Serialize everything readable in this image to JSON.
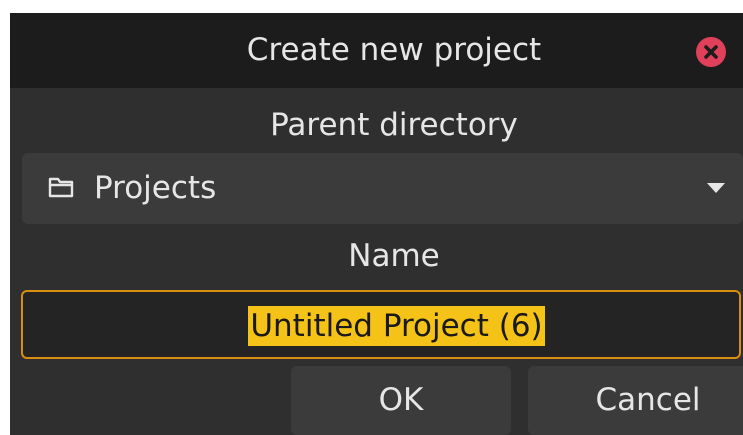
{
  "dialog": {
    "title": "Create new project",
    "close_icon": "close-icon",
    "accent_color": "#d98e12",
    "selection_color": "#f5c318"
  },
  "parent_directory": {
    "label": "Parent directory",
    "selected": "Projects",
    "icon": "folder-icon",
    "dropdown_icon": "chevron-down-icon"
  },
  "name": {
    "label": "Name",
    "value": "Untitled Project (6)"
  },
  "buttons": {
    "ok_label": "OK",
    "cancel_label": "Cancel"
  }
}
